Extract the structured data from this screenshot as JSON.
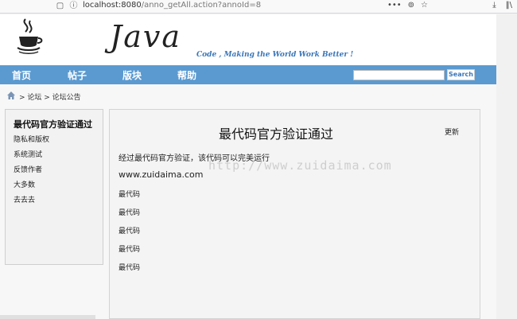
{
  "browser": {
    "url_host": "localhost",
    "url_port": ":8080",
    "url_path": "/anno_getAll.action?annoId=8",
    "menu_dots": "•••"
  },
  "header": {
    "logo_text": "Java",
    "slogan": "Code , Making the World Work Better !"
  },
  "nav": {
    "items": [
      {
        "label": "首页"
      },
      {
        "label": "帖子"
      },
      {
        "label": "版块"
      },
      {
        "label": "帮助"
      }
    ],
    "search_placeholder": "",
    "search_button": "Search"
  },
  "breadcrumb": {
    "text": "> 论坛 > 论坛公告"
  },
  "sidebar": {
    "title": "最代码官方验证通过",
    "items": [
      {
        "label": "隐私和版权"
      },
      {
        "label": "系统测试"
      },
      {
        "label": "反馈作者"
      },
      {
        "label": "大多数"
      },
      {
        "label": "去去去"
      }
    ]
  },
  "main": {
    "title": "最代码官方验证通过",
    "update": "更新",
    "intro": "经过最代码官方验证，该代码可以完美运行",
    "site": "www.zuidaima.com",
    "lines": [
      {
        "text": "最代码"
      },
      {
        "text": "最代码"
      },
      {
        "text": "最代码"
      },
      {
        "text": "最代码"
      },
      {
        "text": "最代码"
      }
    ],
    "watermark": "http://www.zuidaima.com"
  },
  "colors": {
    "nav_bg": "#5b9ad0",
    "slogan": "#3a76b8"
  }
}
